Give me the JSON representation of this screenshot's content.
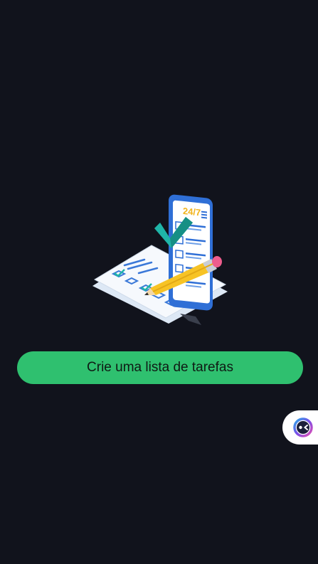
{
  "main": {
    "illustration": {
      "icon": "todo-list-phone-illustration",
      "phone_text": "24/7"
    },
    "cta_button": {
      "label": "Crie uma lista de tarefas"
    }
  },
  "assistant": {
    "icon": "chat-assistant-icon"
  },
  "colors": {
    "background": "#11131c",
    "accent": "#2fc06f",
    "illustration_blue": "#2f6fd6",
    "pencil_yellow": "#f7c325",
    "pencil_pink": "#ee5d8d",
    "check_teal": "#1fb5a8"
  }
}
